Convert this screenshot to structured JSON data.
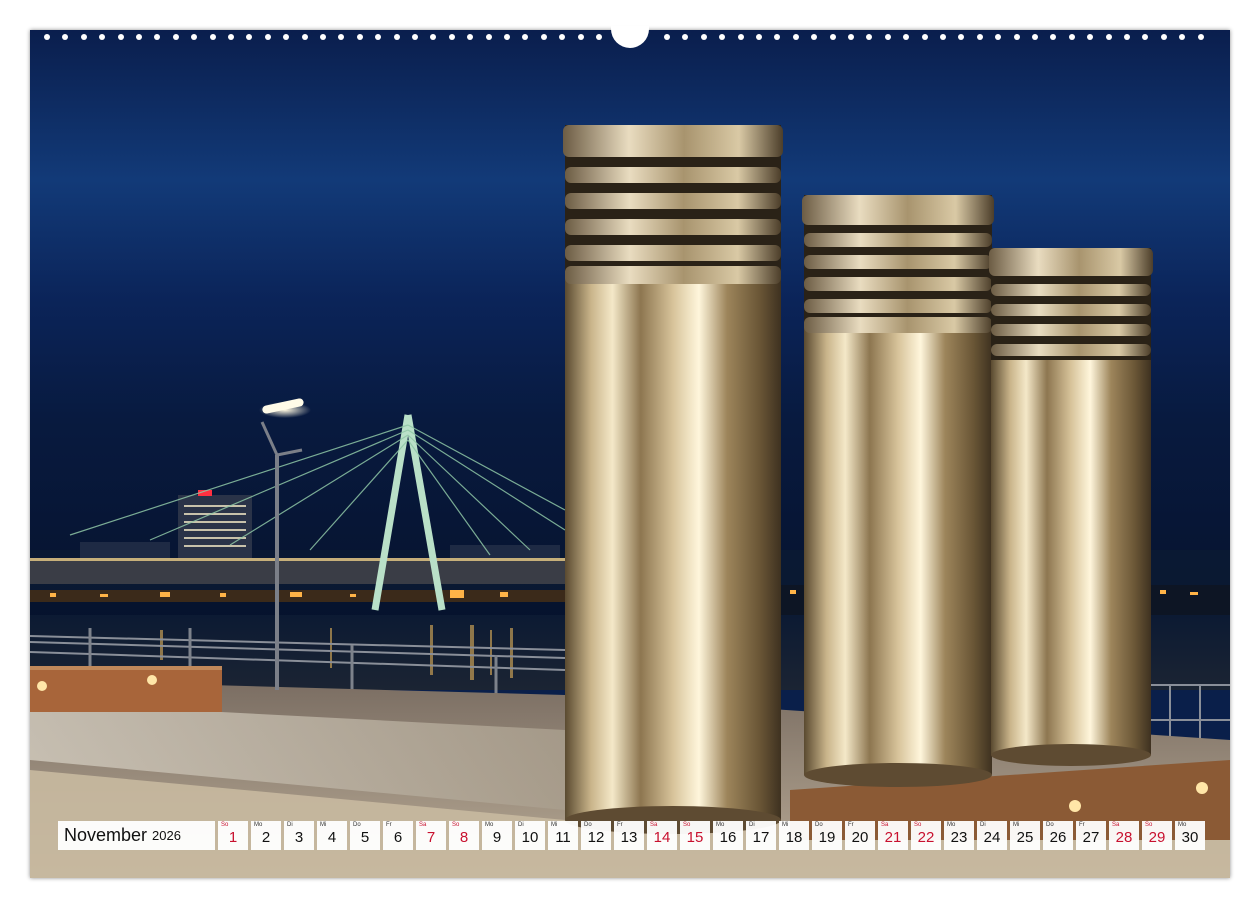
{
  "calendar": {
    "month": "November",
    "year": "2026",
    "days": [
      {
        "num": "1",
        "wd": "So",
        "weekend": true
      },
      {
        "num": "2",
        "wd": "Mo",
        "weekend": false
      },
      {
        "num": "3",
        "wd": "Di",
        "weekend": false
      },
      {
        "num": "4",
        "wd": "Mi",
        "weekend": false
      },
      {
        "num": "5",
        "wd": "Do",
        "weekend": false
      },
      {
        "num": "6",
        "wd": "Fr",
        "weekend": false
      },
      {
        "num": "7",
        "wd": "Sa",
        "weekend": true
      },
      {
        "num": "8",
        "wd": "So",
        "weekend": true
      },
      {
        "num": "9",
        "wd": "Mo",
        "weekend": false
      },
      {
        "num": "10",
        "wd": "Di",
        "weekend": false
      },
      {
        "num": "11",
        "wd": "Mi",
        "weekend": false
      },
      {
        "num": "12",
        "wd": "Do",
        "weekend": false
      },
      {
        "num": "13",
        "wd": "Fr",
        "weekend": false
      },
      {
        "num": "14",
        "wd": "Sa",
        "weekend": true
      },
      {
        "num": "15",
        "wd": "So",
        "weekend": true
      },
      {
        "num": "16",
        "wd": "Mo",
        "weekend": false
      },
      {
        "num": "17",
        "wd": "Di",
        "weekend": false
      },
      {
        "num": "18",
        "wd": "Mi",
        "weekend": false
      },
      {
        "num": "19",
        "wd": "Do",
        "weekend": false
      },
      {
        "num": "20",
        "wd": "Fr",
        "weekend": false
      },
      {
        "num": "21",
        "wd": "Sa",
        "weekend": true
      },
      {
        "num": "22",
        "wd": "So",
        "weekend": true
      },
      {
        "num": "23",
        "wd": "Mo",
        "weekend": false
      },
      {
        "num": "24",
        "wd": "Di",
        "weekend": false
      },
      {
        "num": "25",
        "wd": "Mi",
        "weekend": false
      },
      {
        "num": "26",
        "wd": "Do",
        "weekend": false
      },
      {
        "num": "27",
        "wd": "Fr",
        "weekend": false
      },
      {
        "num": "28",
        "wd": "Sa",
        "weekend": true
      },
      {
        "num": "29",
        "wd": "So",
        "weekend": true
      },
      {
        "num": "30",
        "wd": "Mo",
        "weekend": false
      }
    ]
  },
  "colors": {
    "weekend": "#c8102e",
    "sky": "#0a1f4a",
    "steel": "#b8a27a"
  }
}
